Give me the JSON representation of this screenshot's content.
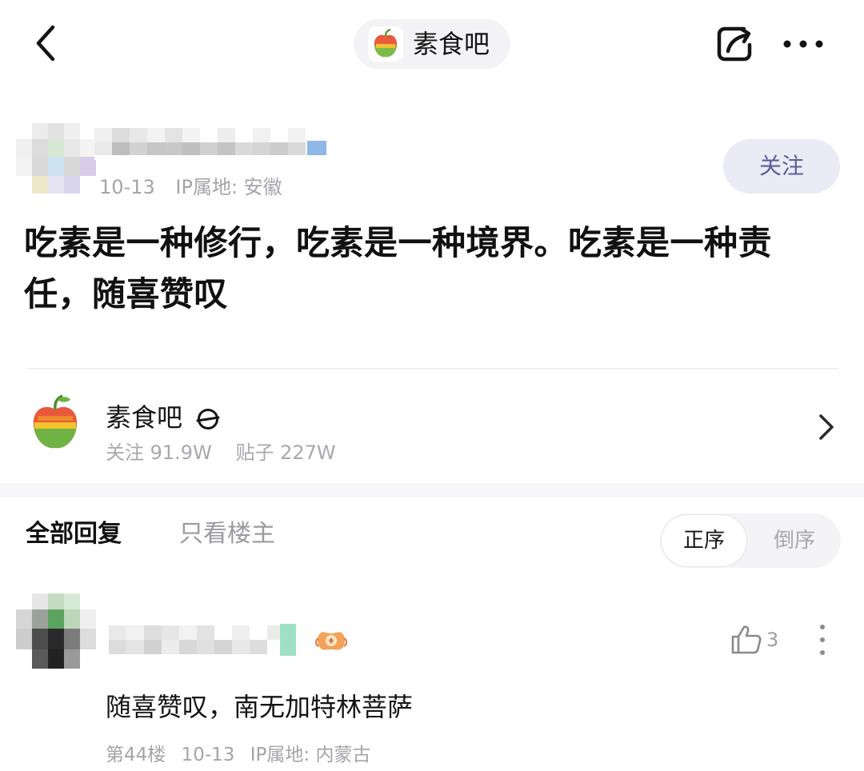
{
  "colors": {
    "accent": "#5b5f9a",
    "follow_bg": "#ebebf5",
    "muted": "#a4a4aa"
  },
  "header": {
    "forum_name": "素食吧",
    "back_icon": "chevron-left-icon",
    "share_icon": "share-arrow-icon",
    "more_icon": "more-horizontal-icon"
  },
  "post": {
    "author_name": "",
    "date": "10-13",
    "ip_location": "IP属地: 安徽",
    "follow_label": "关注",
    "text": "吃素是一种修行，吃素是一种境界。吃素是一种责任，随喜赞叹"
  },
  "forum_card": {
    "name": "素食吧",
    "badge_icon": "official-badge-icon",
    "followers": "关注 91.9W",
    "posts": "贴子 227W"
  },
  "replies": {
    "tab_all": "全部回复",
    "tab_op": "只看楼主",
    "sort_asc": "正序",
    "sort_desc": "倒序"
  },
  "comment": {
    "username": "",
    "like_count": "3",
    "text": "随喜赞叹，南无加特林菩萨",
    "floor": "第44楼",
    "date": "10-13",
    "ip_location": "IP属地: 内蒙古"
  }
}
